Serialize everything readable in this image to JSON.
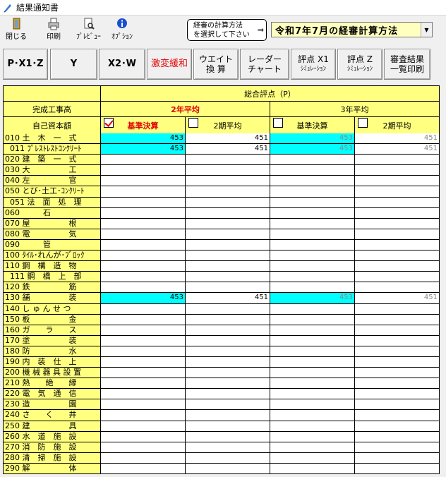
{
  "window": {
    "title": "結果通知書"
  },
  "toolbar": {
    "close": "閉じる",
    "print": "印刷",
    "preview": "ﾌﾟﾚﾋﾞｭｰ",
    "option": "ｵﾌﾟｼｮﾝ"
  },
  "calc_method": {
    "label_line1": "経審の計算方法",
    "label_line2": "を選択して下さい",
    "arrow": "⇒",
    "selected": "令和7年7月の経審計算方法"
  },
  "buttons": {
    "pxz": "P･X1･Z",
    "y": "Y",
    "x2w": "X2･W",
    "gekihen": "激変緩和",
    "weight_1": "ウエイト",
    "weight_2": "換 算",
    "radar_1": "レーダー",
    "radar_2": "チャート",
    "x1sim_1": "評点 X1",
    "x1sim_2": "ｼﾐｭﾚｰｼｮﾝ",
    "zsim_1": "評点 Z",
    "zsim_2": "ｼﾐｭﾚｰｼｮﾝ",
    "list_1": "審査結果",
    "list_2": "一覧印刷"
  },
  "grid": {
    "header_total": "総合評点（P）",
    "kansei": "完成工事高",
    "jiko": "自己資本額",
    "avg2": "2年平均",
    "avg3": "3年平均",
    "kijun": "基準決算",
    "ki2": "2期平均",
    "rows": [
      {
        "name": "010 土　木　一　式",
        "v": [
          "453",
          "451",
          "453",
          "451"
        ]
      },
      {
        "name": "  011 ﾌﾟﾚｽﾄﾚｽﾄｺﾝｸﾘｰﾄ",
        "v": [
          "453",
          "451",
          "453",
          "451"
        ]
      },
      {
        "name": "020 建　築　一　式",
        "v": [
          "",
          "",
          "",
          ""
        ]
      },
      {
        "name": "030 大　　　　　工",
        "v": [
          "",
          "",
          "",
          ""
        ]
      },
      {
        "name": "040 左　　　　　官",
        "v": [
          "",
          "",
          "",
          ""
        ]
      },
      {
        "name": "050 とび･土工･ｺﾝｸﾘｰﾄ",
        "v": [
          "",
          "",
          "",
          ""
        ]
      },
      {
        "name": "  051 法　面　処　理",
        "v": [
          "",
          "",
          "",
          ""
        ]
      },
      {
        "name": "060　　　石",
        "v": [
          "",
          "",
          "",
          ""
        ]
      },
      {
        "name": "070 屋　　　　　根",
        "v": [
          "",
          "",
          "",
          ""
        ]
      },
      {
        "name": "080 電　　　　　気",
        "v": [
          "",
          "",
          "",
          ""
        ]
      },
      {
        "name": "090　　　管",
        "v": [
          "",
          "",
          "",
          ""
        ]
      },
      {
        "name": "100 ﾀｲﾙ･れんが･ﾌﾞﾛｯｸ",
        "v": [
          "",
          "",
          "",
          ""
        ]
      },
      {
        "name": "110 鋼　構　造　物",
        "v": [
          "",
          "",
          "",
          ""
        ]
      },
      {
        "name": "  111 鋼　橋　上　部",
        "v": [
          "",
          "",
          "",
          ""
        ]
      },
      {
        "name": "120 鉄　　　　　筋",
        "v": [
          "",
          "",
          "",
          ""
        ]
      },
      {
        "name": "130 舗　　　　　装",
        "v": [
          "453",
          "451",
          "453",
          "451"
        ]
      },
      {
        "name": "140 し ゅ ん せ つ",
        "v": [
          "",
          "",
          "",
          ""
        ]
      },
      {
        "name": "150 板　　　　　金",
        "v": [
          "",
          "",
          "",
          ""
        ]
      },
      {
        "name": "160 ガ　　ラ　　ス",
        "v": [
          "",
          "",
          "",
          ""
        ]
      },
      {
        "name": "170 塗　　　　　装",
        "v": [
          "",
          "",
          "",
          ""
        ]
      },
      {
        "name": "180 防　　　　　水",
        "v": [
          "",
          "",
          "",
          ""
        ]
      },
      {
        "name": "190 内　装　仕　上",
        "v": [
          "",
          "",
          "",
          ""
        ]
      },
      {
        "name": "200 機 械 器 具 設 置",
        "v": [
          "",
          "",
          "",
          ""
        ]
      },
      {
        "name": "210 熱　　絶　　縁",
        "v": [
          "",
          "",
          "",
          ""
        ]
      },
      {
        "name": "220 電　気　通　信",
        "v": [
          "",
          "",
          "",
          ""
        ]
      },
      {
        "name": "230 造　　　　　園",
        "v": [
          "",
          "",
          "",
          ""
        ]
      },
      {
        "name": "240 さ　　く　　井",
        "v": [
          "",
          "",
          "",
          ""
        ]
      },
      {
        "name": "250 建　　　　　具",
        "v": [
          "",
          "",
          "",
          ""
        ]
      },
      {
        "name": "260 水　道　施　設",
        "v": [
          "",
          "",
          "",
          ""
        ]
      },
      {
        "name": "270 消　防　施　設",
        "v": [
          "",
          "",
          "",
          ""
        ]
      },
      {
        "name": "280 清　掃　施　設",
        "v": [
          "",
          "",
          "",
          ""
        ]
      },
      {
        "name": "290 解　　　　　体",
        "v": [
          "",
          "",
          "",
          ""
        ]
      }
    ]
  },
  "colors": {
    "yellow": "#ffff80",
    "cyan": "#00ffff",
    "red": "#e00000"
  }
}
